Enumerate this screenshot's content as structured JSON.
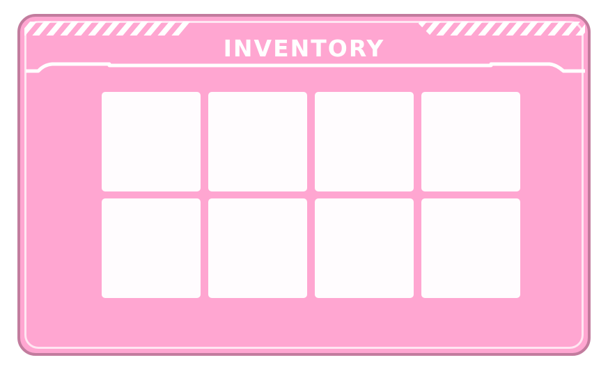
{
  "inventory": {
    "title": "INVENTORY",
    "slot_count": 8,
    "columns": 4,
    "rows": 2
  },
  "colors": {
    "panel_fill": "#ffa6d1",
    "panel_border": "#c27c9e",
    "inner_line": "#ffe6f2",
    "slot_fill": "#fffcfe",
    "title_text": "#ffffff"
  }
}
